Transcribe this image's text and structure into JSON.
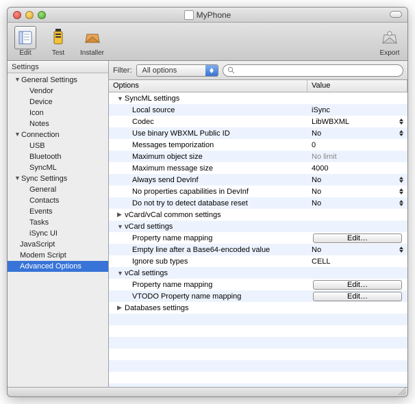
{
  "window": {
    "title": "MyPhone"
  },
  "toolbar": {
    "edit": "Edit",
    "test": "Test",
    "installer": "Installer",
    "export": "Export"
  },
  "sidebar": {
    "header": "Settings",
    "groups": [
      {
        "label": "General Settings",
        "items": [
          "Vendor",
          "Device",
          "Icon",
          "Notes"
        ]
      },
      {
        "label": "Connection",
        "items": [
          "USB",
          "Bluetooth",
          "SyncML"
        ]
      },
      {
        "label": "Sync Settings",
        "items": [
          "General",
          "Contacts",
          "Events",
          "Tasks",
          "iSync UI"
        ]
      }
    ],
    "tail": [
      "JavaScript",
      "Modem Script",
      "Advanced Options"
    ],
    "selected": "Advanced Options"
  },
  "filterbar": {
    "label": "Filter:",
    "combo": "All options",
    "search_placeholder": ""
  },
  "columns": {
    "c0": "Options",
    "c1": "Value"
  },
  "rows": [
    {
      "kind": "group",
      "label": "SyncML settings"
    },
    {
      "kind": "kv",
      "label": "Local source",
      "value": "iSync"
    },
    {
      "kind": "kv",
      "label": "Codec",
      "value": "LibWBXML",
      "updown": true
    },
    {
      "kind": "kv",
      "label": "Use binary WBXML Public ID",
      "value": "No",
      "updown": true
    },
    {
      "kind": "kv",
      "label": "Messages temporization",
      "value": "0"
    },
    {
      "kind": "kv",
      "label": "Maximum object size",
      "value": "No limit",
      "muted": true
    },
    {
      "kind": "kv",
      "label": "Maximum message size",
      "value": "4000"
    },
    {
      "kind": "kv",
      "label": "Always send DevInf",
      "value": "No",
      "updown": true
    },
    {
      "kind": "kv",
      "label": "No properties capabilities in DevInf",
      "value": "No",
      "updown": true
    },
    {
      "kind": "kv",
      "label": "Do not try to detect database reset",
      "value": "No",
      "updown": true
    },
    {
      "kind": "group-collapsed",
      "label": "vCard/vCal common settings"
    },
    {
      "kind": "group",
      "label": "vCard settings"
    },
    {
      "kind": "edit",
      "label": "Property name mapping",
      "btn": "Edit…"
    },
    {
      "kind": "kv",
      "label": "Empty line after a Base64-encoded value",
      "value": "No",
      "updown": true
    },
    {
      "kind": "kv",
      "label": "Ignore sub types",
      "value": "CELL"
    },
    {
      "kind": "group",
      "label": "vCal settings"
    },
    {
      "kind": "edit",
      "label": "Property name mapping",
      "btn": "Edit…"
    },
    {
      "kind": "edit",
      "label": "VTODO Property name mapping",
      "btn": "Edit…"
    },
    {
      "kind": "group-collapsed",
      "label": "Databases settings"
    }
  ]
}
